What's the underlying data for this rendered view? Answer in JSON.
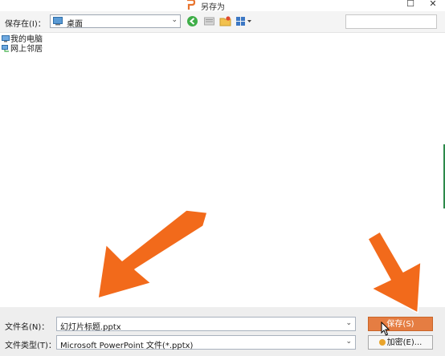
{
  "window": {
    "title": "另存为",
    "close_glyph": "✕",
    "restore_glyph": "☐"
  },
  "toolbar": {
    "save_in_label": "保存在(I)：",
    "location_value": "桌面",
    "dropdown_glyph": "⌄"
  },
  "tree": {
    "items": [
      {
        "label": "我的电脑",
        "icon": "computer-icon"
      },
      {
        "label": "网上邻居",
        "icon": "network-icon"
      }
    ]
  },
  "bottom": {
    "filename_label": "文件名(N)：",
    "filename_value": "幻灯片标题.pptx",
    "filetype_label": "文件类型(T)：",
    "filetype_value": "Microsoft PowerPoint 文件(*.pptx)",
    "save_button": "保存(S)",
    "encrypt_button": "加密(E)..."
  },
  "colors": {
    "accent": "#e57d42",
    "annotation_arrow": "#f26a1b"
  }
}
